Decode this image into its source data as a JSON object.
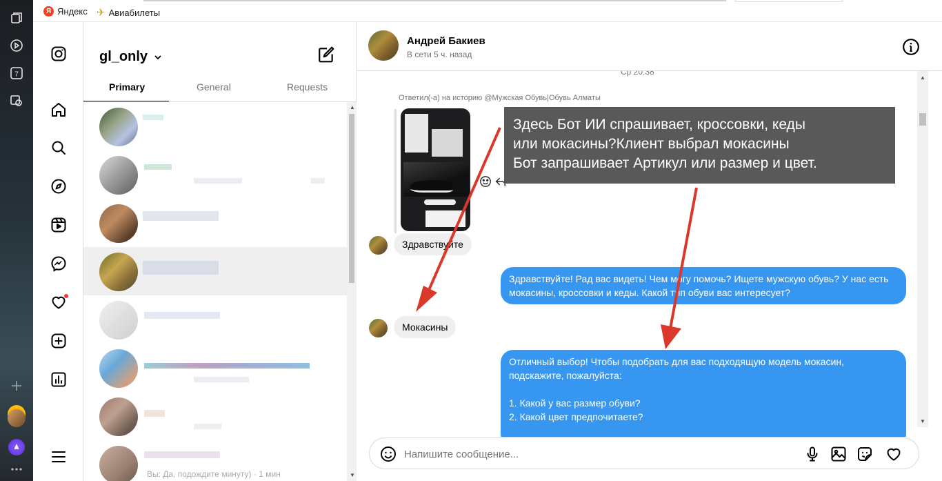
{
  "browser": {
    "bookmarks": [
      {
        "label": "Яндекс",
        "icon": "yandex-icon"
      },
      {
        "label": "Авиабилеты",
        "icon": "airplane-icon"
      }
    ],
    "rail_icons": [
      "tabs-icon",
      "play-icon",
      "calendar-icon",
      "screenshot-icon",
      "add-icon",
      "yandex-browser-icon",
      "profile-icon",
      "alice-icon",
      "more-icon"
    ],
    "calendar_day": "7"
  },
  "instagram": {
    "nav_icons": [
      "instagram-logo-icon",
      "home-icon",
      "search-icon",
      "explore-icon",
      "reels-icon",
      "messenger-icon",
      "heart-icon",
      "create-icon",
      "dashboard-icon",
      "menu-icon"
    ],
    "account": "gl_only",
    "tabs": [
      "Primary",
      "General",
      "Requests"
    ],
    "active_tab": "Primary"
  },
  "chat": {
    "contact_name": "Андрей Бакиев",
    "contact_status": "В сети 5 ч. назад",
    "time_separator": "Ср 20:38",
    "reply_note": "Ответил(-а) на историю @Мужская Обувь|Обувь Алматы",
    "messages": [
      {
        "from": "contact",
        "text": "Здравствуйте"
      },
      {
        "from": "me",
        "text": "Здравствуйте! Рад вас видеть! Чем могу помочь? Ищете мужскую обувь? У нас есть мокасины, кроссовки и кеды. Какой тип обуви вас интересует?"
      },
      {
        "from": "contact",
        "text": "Мокасины"
      },
      {
        "from": "me",
        "text": "Отличный выбор! Чтобы подобрать для вас подходящую модель мокасин, подскажите, пожалуйста:\n\n1. Какой у вас размер обуви?\n2. Какой цвет предпочитаете?"
      }
    ],
    "composer_placeholder": "Напишите сообщение...",
    "partial_preview": "Вы: Да, подождите минуту) · 1 мин"
  },
  "annotation": {
    "text": "Здесь Бот ИИ спрашивает, кроссовки, кеды\nили мокасины?Клиент выбрал мокасины\nБот запрашивает Артикул или размер и цвет.",
    "arrow_color": "#d9382b",
    "box_color": "#595959"
  },
  "colors": {
    "outgoing_bubble": "#3797f0",
    "incoming_bubble": "#efefef",
    "notification_dot": "#ff3040"
  }
}
